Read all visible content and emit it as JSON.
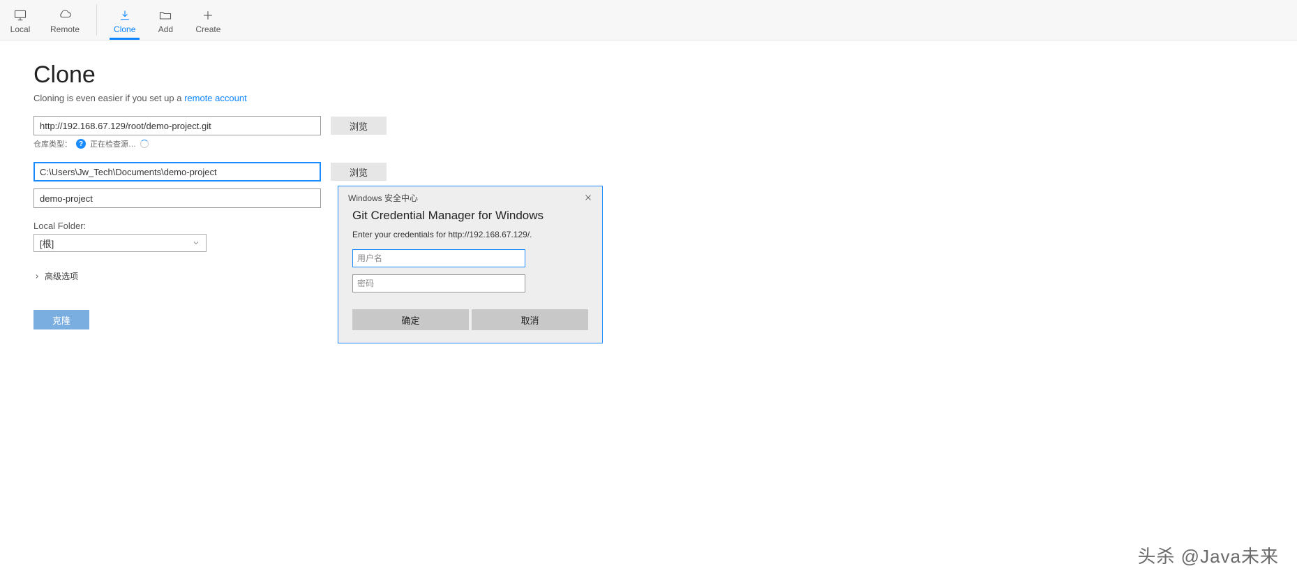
{
  "toolbar": {
    "local": "Local",
    "remote": "Remote",
    "clone": "Clone",
    "add": "Add",
    "create": "Create"
  },
  "page": {
    "title": "Clone",
    "subtext_prefix": "Cloning is even easier if you set up a ",
    "remote_account_link": "remote account"
  },
  "form": {
    "source_url": "http://192.168.67.129/root/demo-project.git",
    "repo_type_label": "仓库类型：",
    "checking_source": "正在检查源…",
    "dest_path": "C:\\Users\\Jw_Tech\\Documents\\demo-project",
    "project_name": "demo-project",
    "browse": "浏览",
    "local_folder_label": "Local Folder:",
    "local_folder_value": "[根]",
    "advanced_options": "高级选项",
    "clone_button": "克隆"
  },
  "dialog": {
    "window_title": "Windows 安全中心",
    "heading": "Git Credential Manager for Windows",
    "prompt": "Enter your credentials for http://192.168.67.129/.",
    "username_placeholder": "用户名",
    "password_placeholder": "密码",
    "ok": "确定",
    "cancel": "取消"
  },
  "watermark": "头杀 @Java未来"
}
